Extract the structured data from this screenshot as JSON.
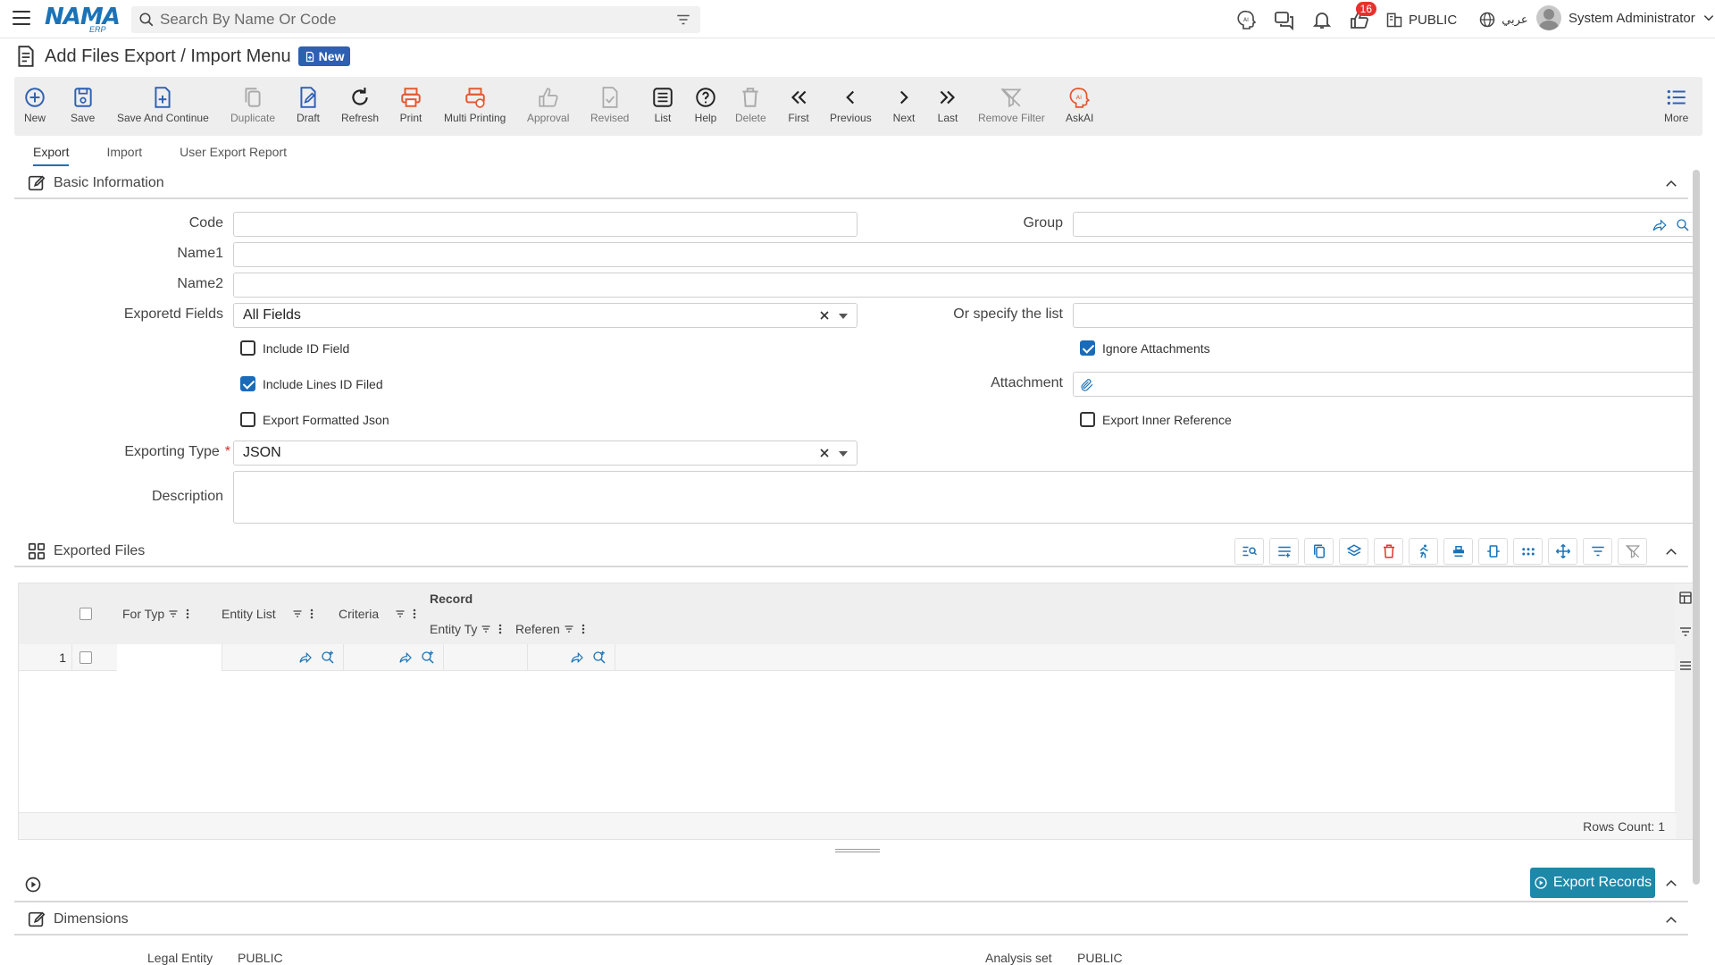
{
  "header": {
    "brand": "NAMA",
    "brand_sub": "ERP",
    "search_placeholder": "Search By Name Or Code",
    "notification_count": "16",
    "entity": "PUBLIC",
    "language": "عربي",
    "user": "System Administrator"
  },
  "page": {
    "title": "Add Files Export / Import Menu",
    "badge": "New"
  },
  "toolbar": {
    "items": [
      {
        "label": "New",
        "icon": "plus-circle-icon",
        "color": "#2d5fb3"
      },
      {
        "label": "Save",
        "icon": "save-icon",
        "color": "#2d5fb3"
      },
      {
        "label": "Save And Continue",
        "icon": "save-continue-icon",
        "color": "#2d5fb3"
      },
      {
        "label": "Duplicate",
        "icon": "duplicate-icon",
        "color": "#aaaaaa"
      },
      {
        "label": "Draft",
        "icon": "draft-icon",
        "color": "#2d5fb3"
      },
      {
        "label": "Refresh",
        "icon": "refresh-icon",
        "color": "#222222"
      },
      {
        "label": "Print",
        "icon": "print-icon",
        "color": "#e4572e"
      },
      {
        "label": "Multi Printing",
        "icon": "multi-print-icon",
        "color": "#e4572e"
      },
      {
        "label": "Approval",
        "icon": "approval-icon",
        "color": "#aaaaaa"
      },
      {
        "label": "Revised",
        "icon": "revised-icon",
        "color": "#aaaaaa"
      },
      {
        "label": "List",
        "icon": "list-icon",
        "color": "#222222"
      },
      {
        "label": "Help",
        "icon": "help-icon",
        "color": "#222222"
      },
      {
        "label": "Delete",
        "icon": "delete-icon",
        "color": "#aaaaaa"
      },
      {
        "label": "First",
        "icon": "first-icon",
        "color": "#222222"
      },
      {
        "label": "Previous",
        "icon": "previous-icon",
        "color": "#222222"
      },
      {
        "label": "Next",
        "icon": "next-icon",
        "color": "#222222"
      },
      {
        "label": "Last",
        "icon": "last-icon",
        "color": "#222222"
      },
      {
        "label": "Remove Filter",
        "icon": "remove-filter-icon",
        "color": "#aaaaaa"
      },
      {
        "label": "AskAI",
        "icon": "ai-icon",
        "color": "#e4572e"
      },
      {
        "label": "More",
        "icon": "more-list-icon",
        "color": "#2d5fb3"
      }
    ]
  },
  "tabs": [
    {
      "label": "Export",
      "active": true
    },
    {
      "label": "Import",
      "active": false
    },
    {
      "label": "User Export Report",
      "active": false
    }
  ],
  "basic_info": {
    "title": "Basic Information",
    "code_label": "Code",
    "code_value": "",
    "group_label": "Group",
    "group_value": "",
    "name1_label": "Name1",
    "name1_value": "",
    "name2_label": "Name2",
    "name2_value": "",
    "exported_fields_label": "Exporetd Fields",
    "exported_fields_value": "All Fields",
    "or_specify_label": "Or specify the list",
    "or_specify_value": "",
    "include_id": {
      "label": "Include ID Field",
      "checked": false
    },
    "ignore_attachments": {
      "label": "Ignore Attachments",
      "checked": true
    },
    "include_lines_id": {
      "label": "Include Lines ID Filed",
      "checked": true
    },
    "attachment_label": "Attachment",
    "export_formatted_json": {
      "label": "Export Formatted Json",
      "checked": false
    },
    "export_inner_reference": {
      "label": "Export Inner Reference",
      "checked": false
    },
    "exporting_type_label": "Exporting Type",
    "required_mark": "*",
    "exporting_type_value": "JSON",
    "description_label": "Description",
    "description_value": ""
  },
  "exported_files": {
    "title": "Exported Files",
    "columns": {
      "for_type": "For Typ",
      "entity_list": "Entity List",
      "criteria": "Criteria",
      "record_group": "Record",
      "entity_type": "Entity Ty",
      "reference": "Referen"
    },
    "rows": [
      {
        "index": "1"
      }
    ],
    "rows_count": "Rows Count: 1"
  },
  "export_records_label": "Export Records",
  "dimensions": {
    "title": "Dimensions",
    "legal_entity_label": "Legal Entity",
    "legal_entity_value": "PUBLIC",
    "analysis_set_label": "Analysis set",
    "analysis_set_value": "PUBLIC"
  }
}
